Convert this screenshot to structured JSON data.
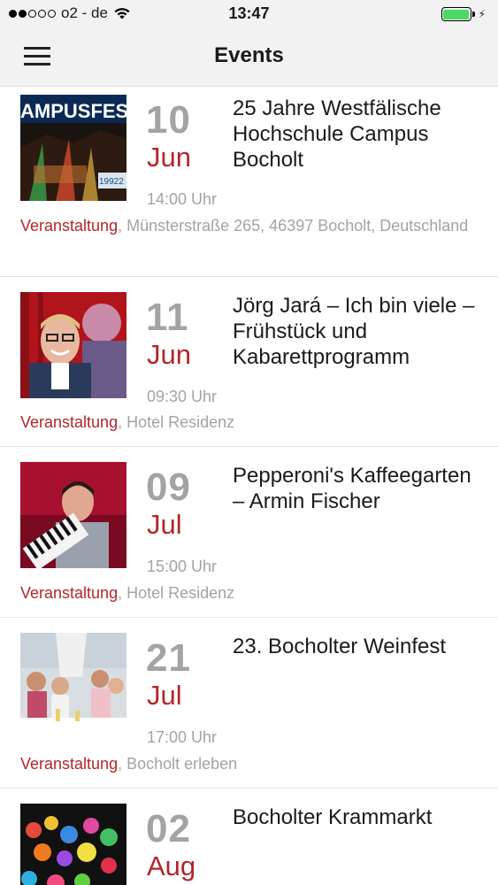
{
  "status_bar": {
    "carrier": "o2 - de",
    "time": "13:47",
    "signal_filled": 2,
    "signal_total": 5
  },
  "nav": {
    "title": "Events",
    "menu_icon": "hamburger-menu-icon"
  },
  "events": [
    {
      "day": "10",
      "month": "Jun",
      "title": "25 Jahre Westfälische Hochschule Campus Bocholt",
      "time": "14:00 Uhr",
      "category": "Veranstaltung",
      "location": ", Münsterstraße 265, 46397 Bocholt, Deutschland",
      "image_text": "AMPUSFES",
      "image_number": "19922"
    },
    {
      "day": "11",
      "month": "Jun",
      "title": "Jörg Jará – Ich bin viele – Frühstück und Kabarettprogramm",
      "time": "09:30 Uhr",
      "category": "Veranstaltung",
      "location": ", Hotel Residenz"
    },
    {
      "day": "09",
      "month": "Jul",
      "title": "Pepperoni's Kaffeegarten – Armin Fischer",
      "time": "15:00 Uhr",
      "category": "Veranstaltung",
      "location": ", Hotel Residenz"
    },
    {
      "day": "21",
      "month": "Jul",
      "title": "23. Bocholter Weinfest",
      "time": "17:00 Uhr",
      "category": "Veranstaltung",
      "location": ", Bocholt erleben"
    },
    {
      "day": "02",
      "month": "Aug",
      "title": "Bocholter Krammarkt",
      "time": "",
      "category": "",
      "location": ""
    }
  ]
}
